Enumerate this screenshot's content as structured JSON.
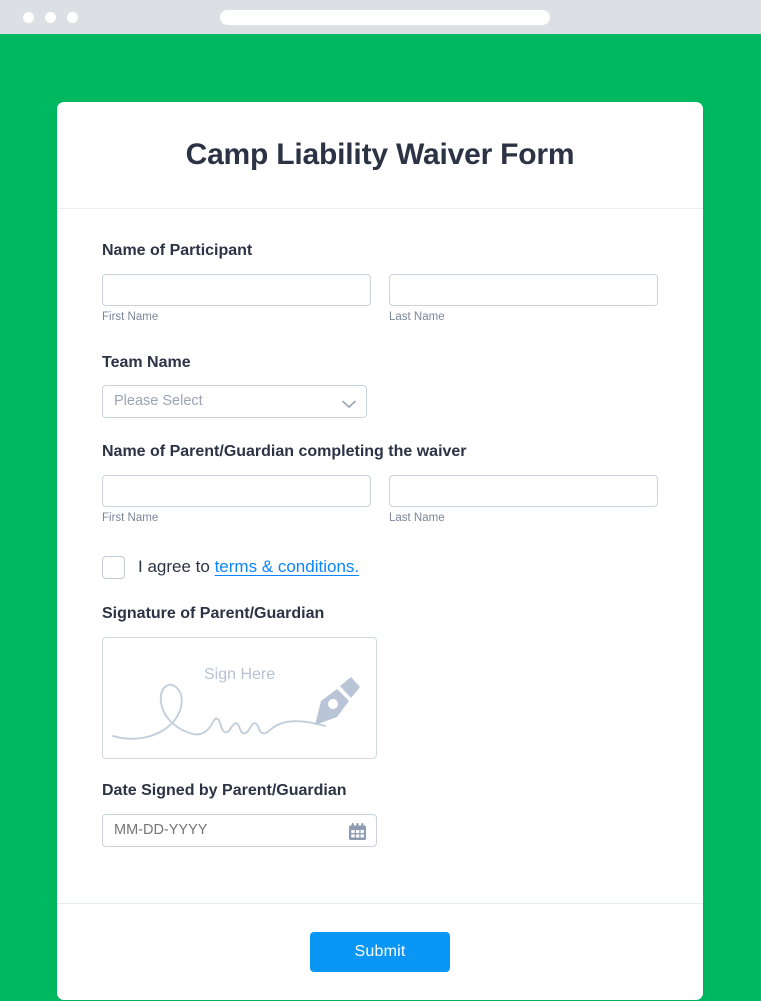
{
  "browser": {
    "traffic_lights": [
      "close",
      "minimize",
      "maximize"
    ],
    "url_value": "",
    "chrome_color": "#dcdfe3"
  },
  "theme": {
    "background_green": "#00b85f",
    "card_background": "#ffffff",
    "title_color": "#2c3345",
    "link_blue": "#0a84ff",
    "submit_blue": "#0a96f5",
    "border_color": "#c8d2e0",
    "placeholder_color": "#9aa4b5",
    "sublabel_color": "#7b8699",
    "signature_hint_color": "#b7c2d2"
  },
  "form": {
    "title": "Camp Liability Waiver Form",
    "participant": {
      "label": "Name of Participant",
      "first_name": {
        "value": "",
        "placeholder": "",
        "sublabel": "First Name"
      },
      "last_name": {
        "value": "",
        "placeholder": "",
        "sublabel": "Last Name"
      }
    },
    "team": {
      "label": "Team Name",
      "selected": "Please Select",
      "chevron_icon": "chevron-down-icon"
    },
    "guardian": {
      "label": "Name of Parent/Guardian completing the waiver",
      "first_name": {
        "value": "",
        "placeholder": "",
        "sublabel": "First Name"
      },
      "last_name": {
        "value": "",
        "placeholder": "",
        "sublabel": "Last Name"
      }
    },
    "agreement": {
      "checked": false,
      "text_before": "I agree to ",
      "link_text": "terms & conditions."
    },
    "signature": {
      "label": "Signature of Parent/Guardian",
      "hint": "Sign Here",
      "pen_icon": "pen-nib-icon",
      "squiggle_icon": "signature-squiggle-icon"
    },
    "date_signed": {
      "label": "Date Signed by Parent/Guardian",
      "value": "",
      "placeholder": "MM-DD-YYYY",
      "calendar_icon": "calendar-icon"
    },
    "submit_label": "Submit"
  }
}
